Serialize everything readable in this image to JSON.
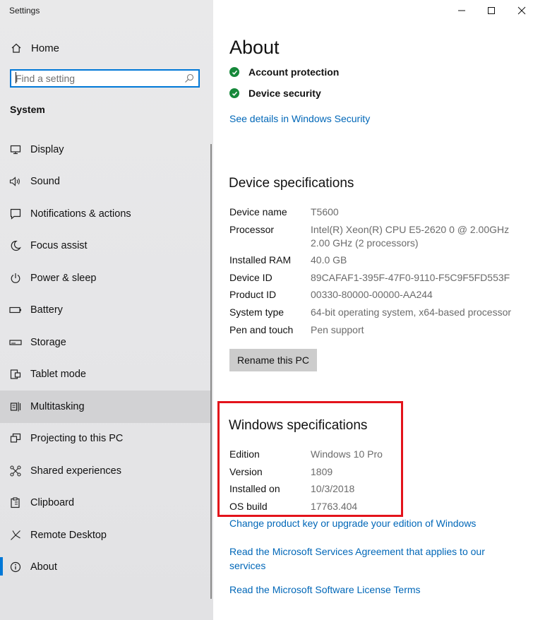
{
  "window": {
    "title": "Settings",
    "controls": {
      "minimize": "—",
      "maximize": "☐",
      "close": "✕"
    }
  },
  "sidebar": {
    "home_label": "Home",
    "search": {
      "placeholder": "Find a setting"
    },
    "section_title": "System",
    "items": [
      {
        "label": "Display",
        "icon": "display-icon"
      },
      {
        "label": "Sound",
        "icon": "speaker-icon"
      },
      {
        "label": "Notifications & actions",
        "icon": "notifications-icon"
      },
      {
        "label": "Focus assist",
        "icon": "moon-icon"
      },
      {
        "label": "Power & sleep",
        "icon": "power-icon"
      },
      {
        "label": "Battery",
        "icon": "battery-icon"
      },
      {
        "label": "Storage",
        "icon": "storage-icon"
      },
      {
        "label": "Tablet mode",
        "icon": "tablet-mode-icon"
      },
      {
        "label": "Multitasking",
        "icon": "multitasking-icon"
      },
      {
        "label": "Projecting to this PC",
        "icon": "projecting-icon"
      },
      {
        "label": "Shared experiences",
        "icon": "shared-experiences-icon"
      },
      {
        "label": "Clipboard",
        "icon": "clipboard-icon"
      },
      {
        "label": "Remote Desktop",
        "icon": "remote-desktop-icon"
      },
      {
        "label": "About",
        "icon": "info-icon"
      }
    ],
    "hovered_item": "Multitasking",
    "active_item": "About"
  },
  "main": {
    "title": "About",
    "protection": [
      {
        "label": "Account protection",
        "status_color": "#16883a"
      },
      {
        "label": "Device security",
        "status_color": "#16883a"
      }
    ],
    "security_link": "See details in Windows Security",
    "device_specs": {
      "heading": "Device specifications",
      "rows": [
        {
          "key": "Device name",
          "value": "T5600"
        },
        {
          "key": "Processor",
          "value": "Intel(R) Xeon(R) CPU E5-2620 0 @ 2.00GHz",
          "value2": "2.00 GHz  (2 processors)"
        },
        {
          "key": "Installed RAM",
          "value": "40.0 GB"
        },
        {
          "key": "Device ID",
          "value": "89CAFAF1-395F-47F0-9110-F5C9F5FD553F"
        },
        {
          "key": "Product ID",
          "value": "00330-80000-00000-AA244"
        },
        {
          "key": "System type",
          "value": "64-bit operating system, x64-based processor"
        },
        {
          "key": "Pen and touch",
          "value": "Pen support"
        }
      ],
      "rename_button": "Rename this PC"
    },
    "windows_specs": {
      "heading": "Windows specifications",
      "rows": [
        {
          "key": "Edition",
          "value": "Windows 10 Pro"
        },
        {
          "key": "Version",
          "value": "1809"
        },
        {
          "key": "Installed on",
          "value": "10/3/2018"
        },
        {
          "key": "OS build",
          "value": "17763.404"
        }
      ]
    },
    "links": {
      "change_key": "Change product key or upgrade your edition of Windows",
      "services_agreement_line1": "Read the Microsoft Services Agreement that applies to our",
      "services_agreement_line2": "services",
      "license_terms": "Read the Microsoft Software License Terms"
    },
    "colors": {
      "accent": "#0078d7",
      "link": "#0067b8",
      "highlight_box": "#e3131b"
    }
  }
}
